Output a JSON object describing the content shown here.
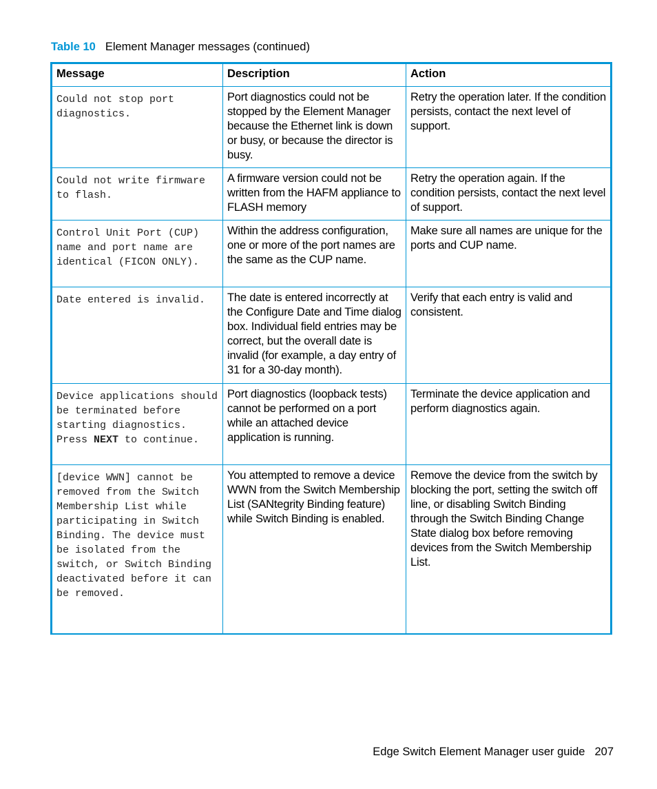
{
  "caption": {
    "table_number": "Table 10",
    "title": "Element Manager messages (continued)"
  },
  "table": {
    "headers": [
      "Message",
      "Description",
      "Action"
    ],
    "rows": [
      {
        "message": "Could not stop port diagnostics.",
        "description": "Port diagnostics could not be stopped by the Element Manager because the Ethernet link is down or busy, or because the director is busy.",
        "action": "Retry the operation later. If the condition persists, contact the next level of support."
      },
      {
        "message": "Could not write firmware to flash.",
        "description": "A firmware version could not be written from the HAFM appliance to FLASH memory",
        "action": "Retry the operation again. If the condition persists, contact the next level of support."
      },
      {
        "message": "Control Unit Port (CUP) name and port name are identical (FICON ONLY).",
        "description": "Within the address configuration, one or more of the port names are the same as the CUP name.",
        "action": "Make sure all names are unique for the ports and CUP name."
      },
      {
        "message": "Date entered is invalid.",
        "description": "The date is entered incorrectly at the Configure Date and Time dialog box. Individual field entries may be correct, but the overall date is invalid (for example, a day entry of 31 for a 30-day month).",
        "action": "Verify that each entry is valid and consistent."
      },
      {
        "message_pre": "Device applications should be terminated before starting diagnostics. Press ",
        "message_bold": "NEXT",
        "message_post": " to continue.",
        "description": "Port diagnostics (loopback tests) cannot be performed on a port while an attached device application is running.",
        "action": "Terminate the device application and perform diagnostics again."
      },
      {
        "message": "[device WWN] cannot be removed from the Switch Membership List while participating in Switch Binding. The device must be isolated from the switch, or Switch Binding deactivated before it can be removed.",
        "description": "You attempted to remove a device WWN from the Switch Membership List (SANtegrity Binding feature) while Switch Binding is enabled.",
        "action": "Remove the device from the switch by blocking the port, setting the switch off line, or disabling Switch Binding through the Switch Binding Change State dialog box before removing devices from the Switch Membership List."
      }
    ]
  },
  "footer": {
    "guide_title": "Edge Switch Element Manager user guide",
    "page_number": "207"
  },
  "colors": {
    "accent": "#0096d6"
  }
}
